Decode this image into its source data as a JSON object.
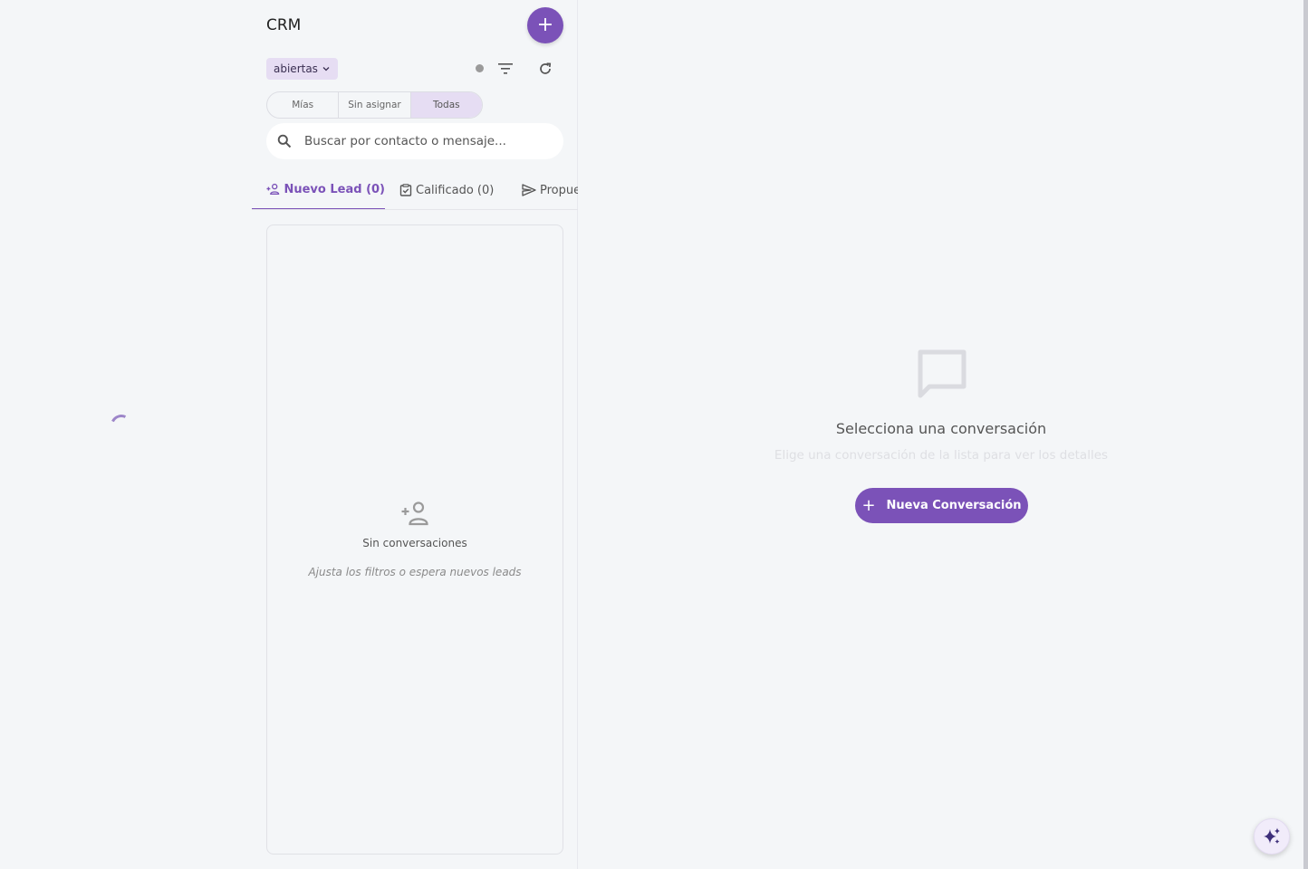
{
  "sidebar": {
    "title": "CRM",
    "add_button": "+",
    "status_filter": "abiertas",
    "segments": [
      {
        "label": "Mías",
        "active": false
      },
      {
        "label": "Sin asignar",
        "active": false
      },
      {
        "label": "Todas",
        "active": true
      }
    ],
    "search": {
      "placeholder": "Buscar por contacto o mensaje..."
    },
    "tabs": [
      {
        "label": "Nuevo Lead (0)",
        "icon": "person-add-icon",
        "active": true
      },
      {
        "label": "Calificado (0)",
        "icon": "checkbox-icon",
        "active": false
      },
      {
        "label": "Propue",
        "icon": "send-icon",
        "active": false
      }
    ],
    "empty": {
      "title": "Sin conversaciones",
      "subtitle": "Ajusta los filtros o espera nuevos leads"
    }
  },
  "main": {
    "title": "Selecciona una conversación",
    "subtitle": "Elige una conversación de la lista para ver los detalles",
    "new_button": "Nueva Conversación",
    "new_button_icon": "+"
  },
  "colors": {
    "accent": "#7b52b8",
    "accent_light": "#e6ddf3",
    "background": "#f4f6f8"
  }
}
